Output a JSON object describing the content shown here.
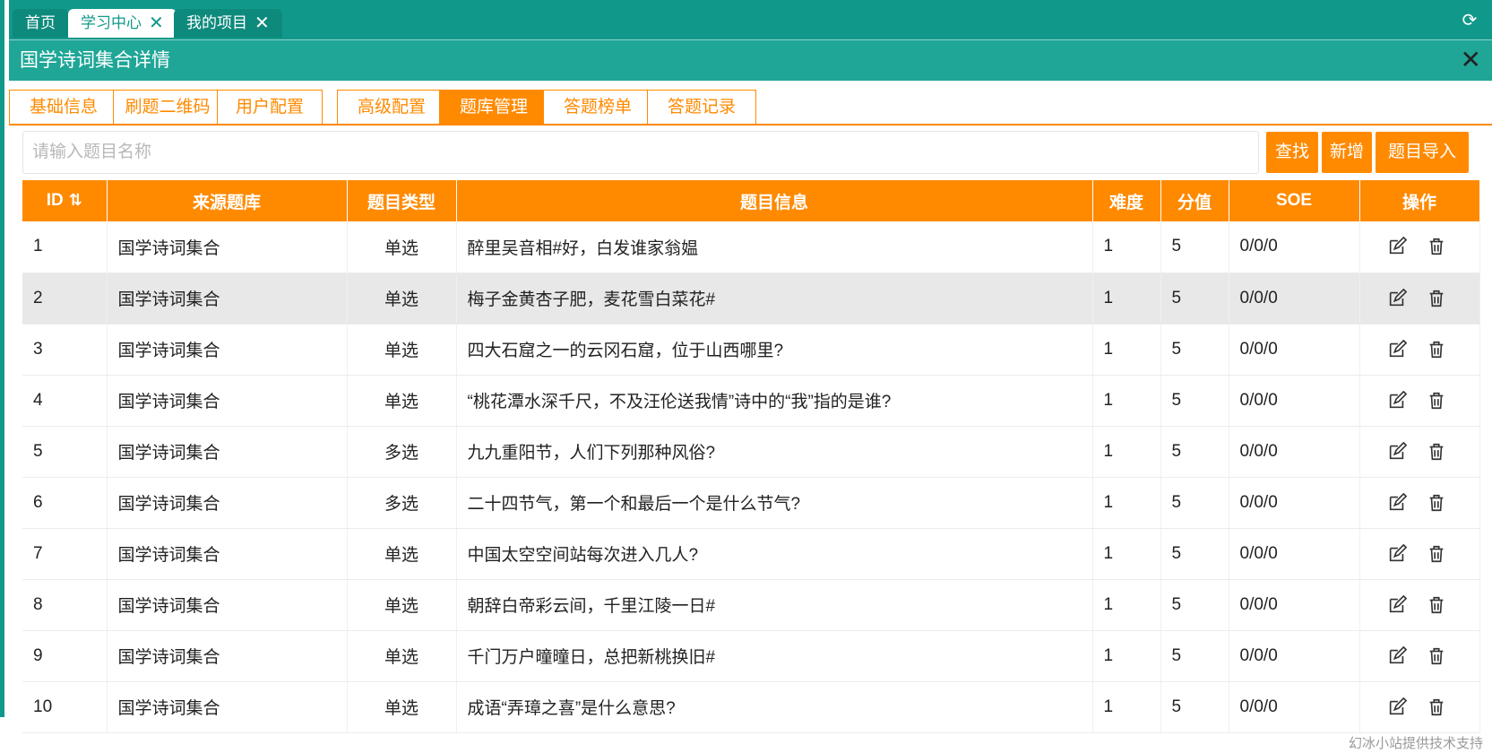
{
  "top_tabs": [
    {
      "label": "首页"
    },
    {
      "label": "学习中心"
    },
    {
      "label": "我的项目"
    }
  ],
  "panel": {
    "title": "国学诗词集合详情"
  },
  "sub_tabs": [
    "基础信息",
    "刷题二维码",
    "用户配置",
    "高级配置",
    "题库管理",
    "答题榜单",
    "答题记录"
  ],
  "search": {
    "placeholder": "请输入题目名称",
    "value": ""
  },
  "buttons": {
    "find": "查找",
    "add": "新增",
    "import": "题目导入"
  },
  "table": {
    "headers": [
      "ID",
      "来源题库",
      "题目类型",
      "题目信息",
      "难度",
      "分值",
      "SOE",
      "操作"
    ],
    "rows": [
      {
        "id": "1",
        "source": "国学诗词集合",
        "type": "单选",
        "info": "醉里吴音相#好，白发谁家翁媪",
        "difficulty": "1",
        "score": "5",
        "soe": "0/0/0"
      },
      {
        "id": "2",
        "source": "国学诗词集合",
        "type": "单选",
        "info": "梅子金黄杏子肥，麦花雪白菜花#",
        "difficulty": "1",
        "score": "5",
        "soe": "0/0/0"
      },
      {
        "id": "3",
        "source": "国学诗词集合",
        "type": "单选",
        "info": "四大石窟之一的云冈石窟，位于山西哪里?",
        "difficulty": "1",
        "score": "5",
        "soe": "0/0/0"
      },
      {
        "id": "4",
        "source": "国学诗词集合",
        "type": "单选",
        "info": "“桃花潭水深千尺，不及汪伦送我情”诗中的“我”指的是谁?",
        "difficulty": "1",
        "score": "5",
        "soe": "0/0/0"
      },
      {
        "id": "5",
        "source": "国学诗词集合",
        "type": "多选",
        "info": "九九重阳节，人们下列那种风俗?",
        "difficulty": "1",
        "score": "5",
        "soe": "0/0/0"
      },
      {
        "id": "6",
        "source": "国学诗词集合",
        "type": "多选",
        "info": "二十四节气，第一个和最后一个是什么节气?",
        "difficulty": "1",
        "score": "5",
        "soe": "0/0/0"
      },
      {
        "id": "7",
        "source": "国学诗词集合",
        "type": "单选",
        "info": "中国太空空间站每次进入几人?",
        "difficulty": "1",
        "score": "5",
        "soe": "0/0/0"
      },
      {
        "id": "8",
        "source": "国学诗词集合",
        "type": "单选",
        "info": "朝辞白帝彩云间，千里江陵一日#",
        "difficulty": "1",
        "score": "5",
        "soe": "0/0/0"
      },
      {
        "id": "9",
        "source": "国学诗词集合",
        "type": "单选",
        "info": "千门万户曈曈日，总把新桃换旧#",
        "difficulty": "1",
        "score": "5",
        "soe": "0/0/0"
      },
      {
        "id": "10",
        "source": "国学诗词集合",
        "type": "单选",
        "info": "成语“弄璋之喜”是什么意思?",
        "difficulty": "1",
        "score": "5",
        "soe": "0/0/0"
      }
    ]
  },
  "footer": "幻冰小站提供技术支持",
  "colors": {
    "teal": "#10998a",
    "orange": "#ff8a00"
  }
}
